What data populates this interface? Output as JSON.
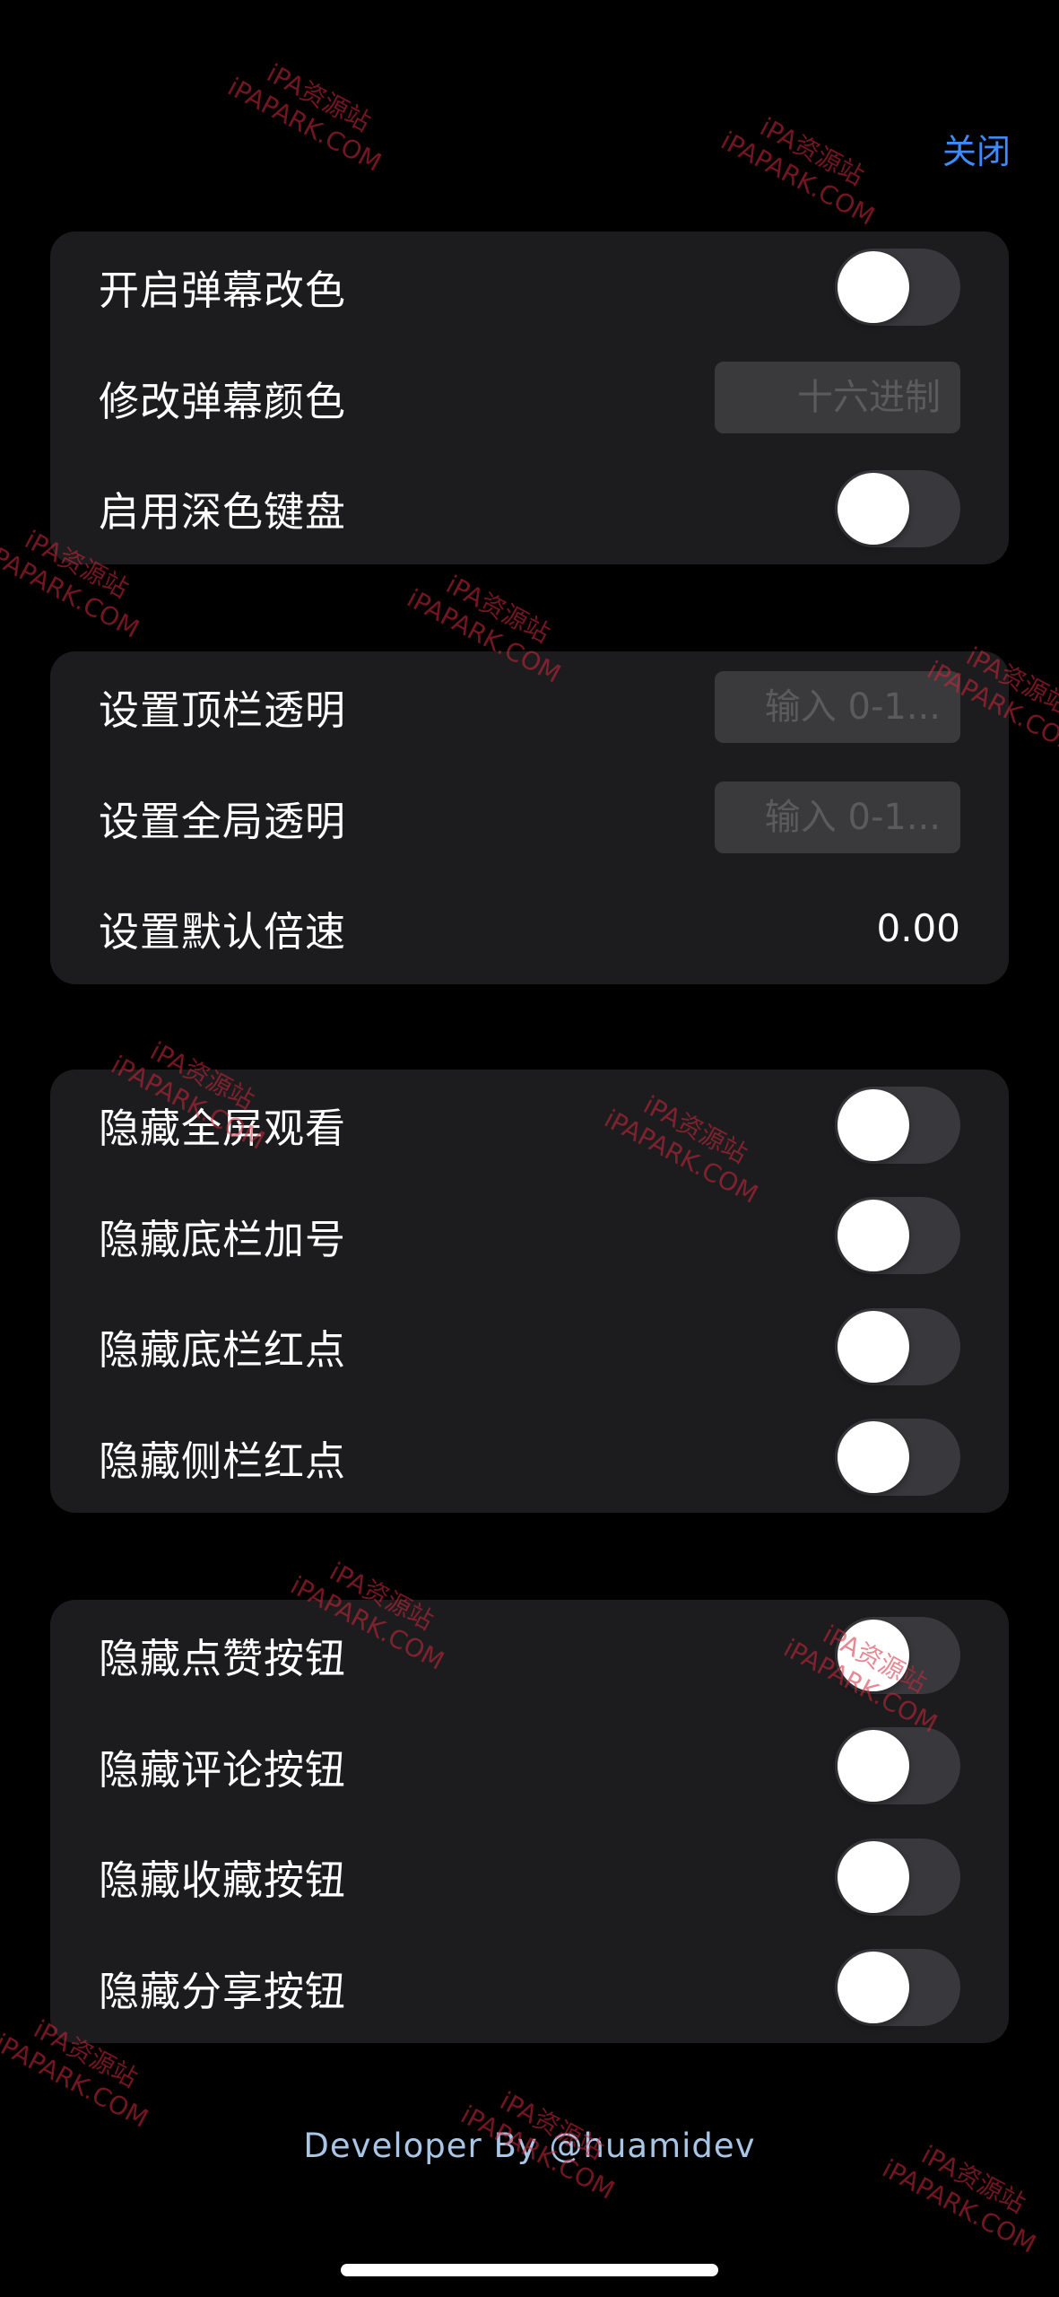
{
  "header": {
    "close_label": "关闭"
  },
  "groups": [
    {
      "rows": [
        {
          "label": "开启弹幕改色",
          "type": "toggle",
          "on": false
        },
        {
          "label": "修改弹幕颜色",
          "type": "input",
          "placeholder": "十六进制"
        },
        {
          "label": "启用深色键盘",
          "type": "toggle",
          "on": false
        }
      ]
    },
    {
      "rows": [
        {
          "label": "设置顶栏透明",
          "type": "input",
          "placeholder": "输入 0-1..."
        },
        {
          "label": "设置全局透明",
          "type": "input",
          "placeholder": "输入 0-1..."
        },
        {
          "label": "设置默认倍速",
          "type": "value",
          "value": "0.00"
        }
      ]
    },
    {
      "rows": [
        {
          "label": "隐藏全屏观看",
          "type": "toggle",
          "on": false
        },
        {
          "label": "隐藏底栏加号",
          "type": "toggle",
          "on": false
        },
        {
          "label": "隐藏底栏红点",
          "type": "toggle",
          "on": false
        },
        {
          "label": "隐藏侧栏红点",
          "type": "toggle",
          "on": false
        }
      ]
    },
    {
      "rows": [
        {
          "label": "隐藏点赞按钮",
          "type": "toggle",
          "on": false
        },
        {
          "label": "隐藏评论按钮",
          "type": "toggle",
          "on": false
        },
        {
          "label": "隐藏收藏按钮",
          "type": "toggle",
          "on": false
        },
        {
          "label": "隐藏分享按钮",
          "type": "toggle",
          "on": false
        }
      ]
    }
  ],
  "footer": {
    "text": "Developer By @huamidev"
  },
  "watermark": {
    "line1": "iPA资源站",
    "line2": "iPAPARK.COM"
  },
  "colors": {
    "background": "#000000",
    "group_background": "#1c1c1e",
    "accent": "#3d8bff",
    "toggle_off_track": "#39393d",
    "footer_text": "#a9c6e6",
    "watermark": "#d2283c"
  }
}
